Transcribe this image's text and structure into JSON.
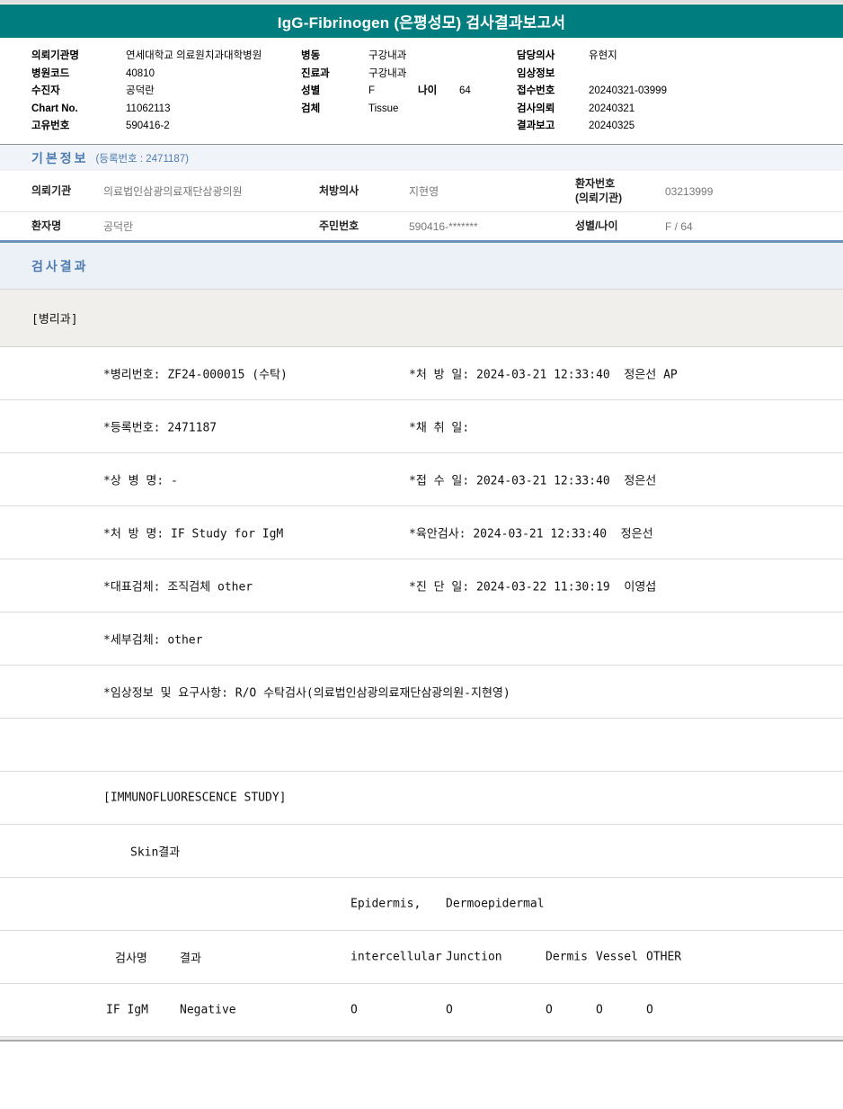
{
  "colors": {
    "brand_teal": "#007d7e",
    "accent_blue": "#4e7cb0"
  },
  "title": "IgG-Fibrinogen (은평성모) 검사결과보고서",
  "header": {
    "left": [
      {
        "label": "의뢰기관명",
        "value": "연세대학교 의료원치과대학병원"
      },
      {
        "label": "병원코드",
        "value": "40810"
      },
      {
        "label": "수진자",
        "value": "공덕란"
      },
      {
        "label": "Chart No.",
        "value": "11062113"
      },
      {
        "label": "고유번호",
        "value": "590416-2"
      }
    ],
    "middle": [
      {
        "label": "병동",
        "value": "구강내과"
      },
      {
        "label": "진료과",
        "value": "구강내과"
      },
      {
        "label": "성별",
        "value": "F"
      },
      {
        "label": "검체",
        "value": "Tissue"
      }
    ],
    "age": {
      "label": "나이",
      "value": "64"
    },
    "right": [
      {
        "label": "담당의사",
        "value": "유현지"
      },
      {
        "label": "임상정보",
        "value": ""
      },
      {
        "label": "접수번호",
        "value": "20240321-03999"
      },
      {
        "label": "검사의뢰",
        "value": "20240321"
      },
      {
        "label": "결과보고",
        "value": "20240325"
      }
    ]
  },
  "basic_info": {
    "title": "기본정보",
    "reg_no": "(등록번호 : 2471187)",
    "rows": [
      {
        "c1_label": "의뢰기관",
        "c1_value": "의료법인삼광의료재단삼광의원",
        "c2_label": "처방의사",
        "c2_value": "지현영",
        "c3_label": "환자번호\n(의뢰기관)",
        "c3_value": "03213999"
      },
      {
        "c1_label": "환자명",
        "c1_value": "공덕란",
        "c2_label": "주민번호",
        "c2_value": "590416-*******",
        "c3_label": "성별/나이",
        "c3_value": "F / 64"
      }
    ]
  },
  "results": {
    "title": "검사결과",
    "department": "[병리과]",
    "details": [
      {
        "left": "*병리번호: ZF24-000015 (수탁)",
        "right": "*처 방 일: 2024-03-21 12:33:40  정은선 AP"
      },
      {
        "left": "*등록번호: 2471187",
        "right": "*채 취 일:"
      },
      {
        "left": "*상 병 명: -",
        "right": "*접 수 일: 2024-03-21 12:33:40  정은선"
      },
      {
        "left": "*처 방 명: IF Study for IgM",
        "right": "*육안검사: 2024-03-21 12:33:40  정은선"
      },
      {
        "left": "*대표검체: 조직검체 other",
        "right": "*진 단 일: 2024-03-22 11:30:19  이영섭"
      },
      {
        "left": "*세부검체: other",
        "right": ""
      },
      {
        "left": "*임상정보 및 요구사항: R/O 수탁검사(의료법인삼광의료재단삼광의원-지현영)",
        "right": ""
      }
    ],
    "study_title": "[IMMUNOFLUORESCENCE STUDY]",
    "skin_title": "Skin결과",
    "if_table": {
      "group_header": {
        "col3": "Epidermis,",
        "col4": "Dermoepidermal"
      },
      "columns": [
        "검사명",
        "결과",
        "intercellular",
        "Junction",
        "Dermis",
        "Vessel",
        "OTHER"
      ],
      "rows": [
        [
          "IF IgM",
          "Negative",
          "O",
          "O",
          "O",
          "O",
          "O"
        ]
      ]
    }
  }
}
